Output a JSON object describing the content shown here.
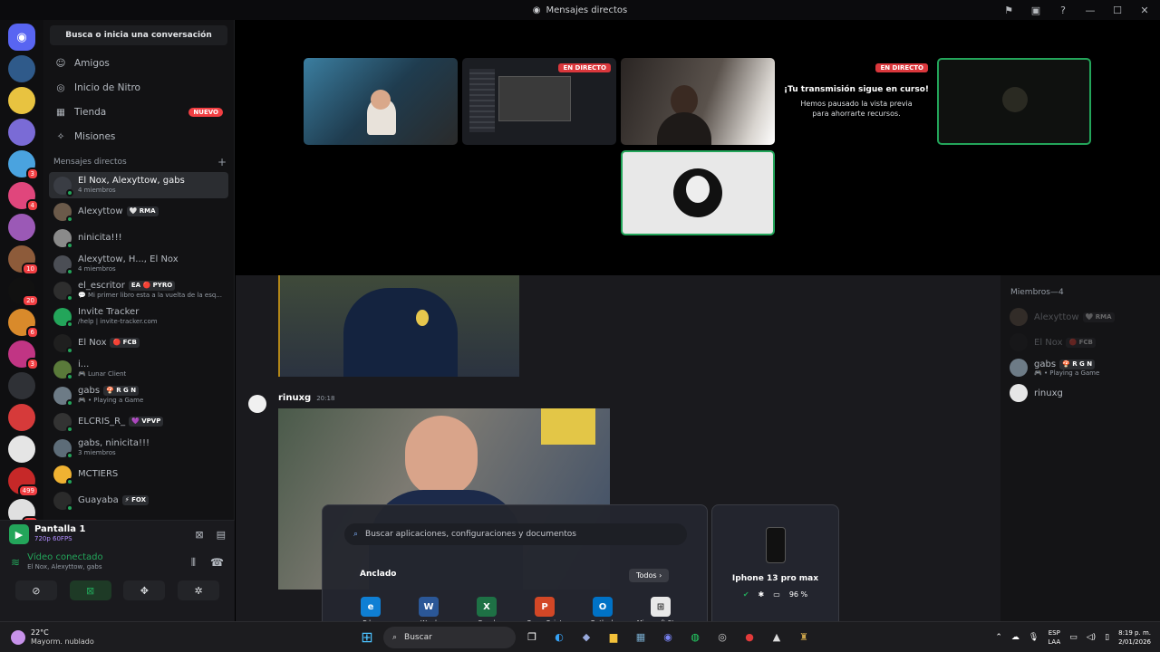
{
  "window": {
    "title": "Mensajes directos"
  },
  "sidebar": {
    "search_label": "Busca o inicia una conversación",
    "nav": [
      {
        "label": "Amigos",
        "icon": "friends-icon"
      },
      {
        "label": "Inicio de Nitro",
        "icon": "nitro-icon"
      },
      {
        "label": "Tienda",
        "icon": "store-icon",
        "badge": "NUEVO"
      },
      {
        "label": "Misiones",
        "icon": "quests-icon"
      }
    ],
    "dm_header": "Mensajes directos",
    "dm_add": "+",
    "dms": [
      {
        "name": "El Nox, Alexyttow, gabs",
        "sub": "4 miembros",
        "tag": "",
        "active": true,
        "avatar_color": "#3a3d44"
      },
      {
        "name": "Alexyttow",
        "sub": "",
        "tag": "🤍 RMA",
        "avatar_color": "#6b5a4a"
      },
      {
        "name": "ninicita!!!",
        "sub": "",
        "tag": "",
        "avatar_color": "#8a8a8a"
      },
      {
        "name": "Alexyttow, H..., El Nox",
        "sub": "4 miembros",
        "tag": "",
        "avatar_color": "#4b4e55"
      },
      {
        "name": "el_escritor",
        "sub": "💬 Mi primer libro esta a la vuelta de la esq...",
        "tag": "EA 🔴 PYRO",
        "avatar_color": "#2e2e2e"
      },
      {
        "name": "Invite Tracker",
        "sub": "/help | invite-tracker.com",
        "tag": "",
        "avatar_color": "#23a55a"
      },
      {
        "name": "El Nox",
        "sub": "",
        "tag": "🔴 FCB",
        "avatar_color": "#1f1f1f"
      },
      {
        "name": "i...",
        "sub": "🎮 Lunar Client",
        "tag": "",
        "avatar_color": "#5a7a3a"
      },
      {
        "name": "gabs",
        "sub": "🎮 • Playing a Game",
        "tag": "🍄 R G N",
        "avatar_color": "#6d7b86"
      },
      {
        "name": "ELCRIS_R_",
        "sub": "",
        "tag": "💜 VPVP",
        "avatar_color": "#333"
      },
      {
        "name": "gabs, ninicita!!!",
        "sub": "3 miembros",
        "tag": "",
        "avatar_color": "#5d6c78"
      },
      {
        "name": "MCTIERS",
        "sub": "",
        "tag": "",
        "avatar_color": "#f0b232"
      },
      {
        "name": "Guayaba",
        "sub": "",
        "tag": "⚡ FOX",
        "avatar_color": "#2b2b2b"
      }
    ]
  },
  "guilds": [
    {
      "label": "discord-home",
      "color": "#5865f2",
      "badge": ""
    },
    {
      "label": "server",
      "color": "#2f5a8a",
      "badge": ""
    },
    {
      "label": "mine-tiers",
      "color": "#e8c340",
      "badge": ""
    },
    {
      "label": "server",
      "color": "#7a6bd6",
      "badge": ""
    },
    {
      "label": "server",
      "color": "#4aa3df",
      "badge": "3"
    },
    {
      "label": "server",
      "color": "#e0467c",
      "badge": "4"
    },
    {
      "label": "server",
      "color": "#9b59b6",
      "badge": ""
    },
    {
      "label": "server",
      "color": "#8d5b3a",
      "badge": "10"
    },
    {
      "label": "server",
      "color": "#111",
      "badge": "20"
    },
    {
      "label": "server",
      "color": "#d98a2b",
      "badge": "6"
    },
    {
      "label": "server",
      "color": "#c13584",
      "badge": "3"
    },
    {
      "label": "server",
      "color": "#2f3136",
      "badge": ""
    },
    {
      "label": "server",
      "color": "#d63a3a",
      "badge": ""
    },
    {
      "label": "server",
      "color": "#e5e5e5",
      "badge": ""
    },
    {
      "label": "server",
      "color": "#c62828",
      "badge": "499"
    },
    {
      "label": "server",
      "color": "#e0e0e0",
      "badge": "20"
    }
  ],
  "guild_new": "NUEVO",
  "user_panel": {
    "screen_title": "Pantalla 1",
    "screen_sub": "720p 60FPS",
    "voice_status": "Vídeo conectado",
    "voice_channel": "El Nox, Alexyttow, gabs"
  },
  "stage": {
    "live_label": "EN DIRECTO",
    "paused_title": "¡Tu transmisión sigue en curso!",
    "paused_sub": "Hemos pausado la vista previa para ahorrarte recursos."
  },
  "chat": {
    "author": "rinuxg",
    "time": "20:18"
  },
  "members": {
    "title": "Miembros—4",
    "list": [
      {
        "name": "Alexyttow",
        "tag": "🤍 RMA",
        "sub": "",
        "color": "#6b5a4a",
        "dim": true
      },
      {
        "name": "El Nox",
        "tag": "🔴 FCB",
        "sub": "",
        "color": "#1f1f1f",
        "dim": true
      },
      {
        "name": "gabs",
        "tag": "🍄 R G N",
        "sub": "🎮 • Playing a Game",
        "color": "#6d7b86",
        "dim": false
      },
      {
        "name": "rinuxg",
        "tag": "",
        "sub": "",
        "color": "#e6e6e6",
        "dim": false
      }
    ]
  },
  "start_menu": {
    "search_placeholder": "Buscar aplicaciones, configuraciones y documentos",
    "pinned": "Anclado",
    "all": "Todos",
    "apps": [
      {
        "label": "Edge",
        "color": "#0f7fd4",
        "glyph": "e"
      },
      {
        "label": "Word",
        "color": "#2b5797",
        "glyph": "W"
      },
      {
        "label": "Excel",
        "color": "#1e7145",
        "glyph": "X"
      },
      {
        "label": "PowerPoint",
        "color": "#d24726",
        "glyph": "P"
      },
      {
        "label": "Outlook",
        "color": "#0072c6",
        "glyph": "O"
      },
      {
        "label": "Microsoft Store",
        "color": "#e8e8e8",
        "glyph": "⊞"
      }
    ]
  },
  "phone": {
    "name": "Iphone 13 pro max",
    "battery": "96 %"
  },
  "taskbar": {
    "weather_temp": "22°C",
    "weather_desc": "Mayorm. nublado",
    "search": "Buscar",
    "lang1": "ESP",
    "lang2": "LAA",
    "time": "8:19 p. m.",
    "date": "2/01/2026"
  }
}
